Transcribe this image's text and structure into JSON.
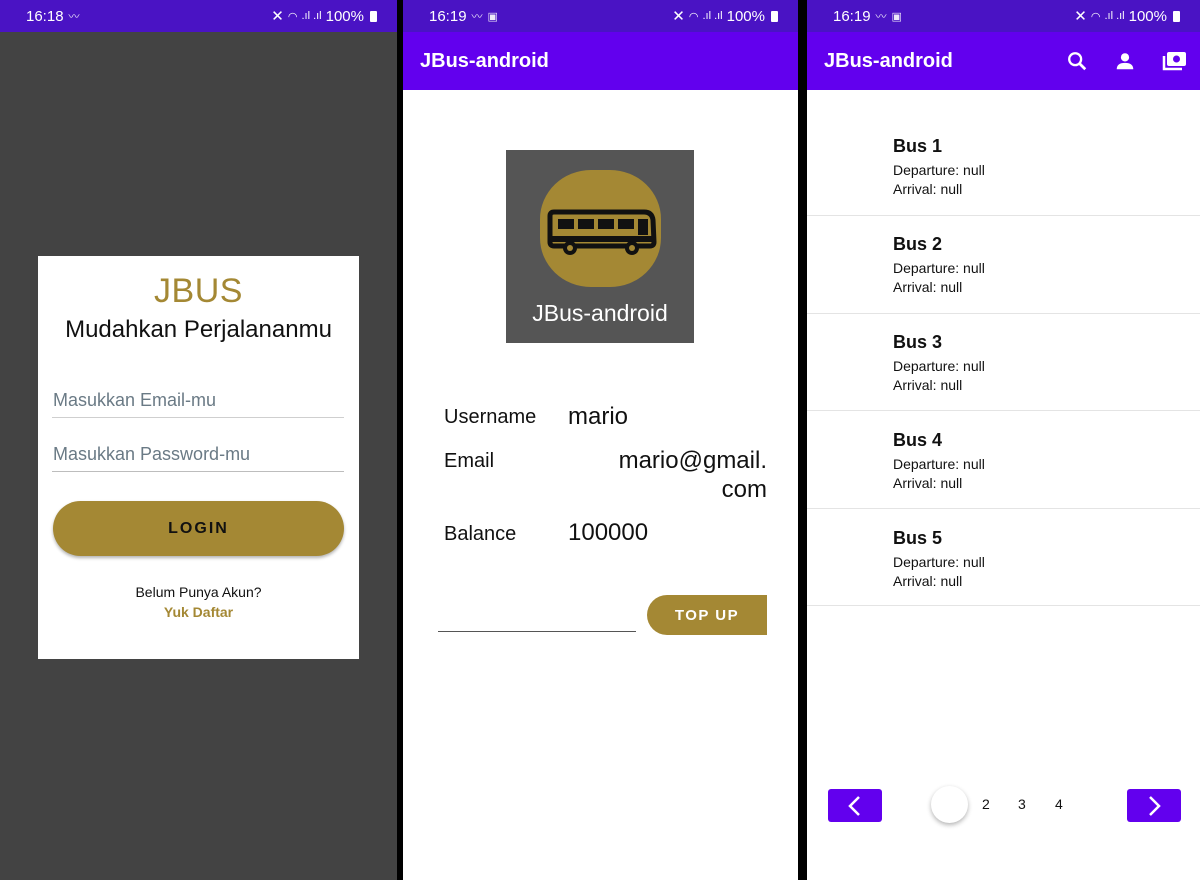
{
  "login_screen": {
    "status": {
      "time": "16:18",
      "battery": "100%"
    },
    "brand": "JBUS",
    "tagline": "Mudahkan Perjalananmu",
    "email_placeholder": "Masukkan Email-mu",
    "password_placeholder": "Masukkan Password-mu",
    "login_label": "LOGIN",
    "no_account_text": "Belum Punya Akun?",
    "register_link": "Yuk Daftar"
  },
  "profile_screen": {
    "status": {
      "time": "16:19",
      "battery": "100%"
    },
    "app_title": "JBus-android",
    "logo_text": "JBus-android",
    "username_label": "Username",
    "username_value": "mario",
    "email_label": "Email",
    "email_value": "mario@gmail.com",
    "balance_label": "Balance",
    "balance_value": "100000",
    "topup_label": "TOP UP"
  },
  "bus_list_screen": {
    "status": {
      "time": "16:19",
      "battery": "100%"
    },
    "app_title": "JBus-android",
    "buses": [
      {
        "name": "Bus 1",
        "departure": "Departure: null",
        "arrival": "Arrival: null"
      },
      {
        "name": "Bus 2",
        "departure": "Departure: null",
        "arrival": "Arrival: null"
      },
      {
        "name": "Bus 3",
        "departure": "Departure: null",
        "arrival": "Arrival: null"
      },
      {
        "name": "Bus 4",
        "departure": "Departure: null",
        "arrival": "Arrival: null"
      },
      {
        "name": "Bus 5",
        "departure": "Departure: null",
        "arrival": "Arrival: null"
      }
    ],
    "pages": [
      "2",
      "3",
      "4"
    ]
  },
  "colors": {
    "accent_gold": "#a48834",
    "primary_purple": "#6200ee",
    "statusbar_purple": "#4a13c4"
  },
  "icons": {
    "search": "search-icon",
    "profile": "person-icon",
    "payment": "payment-icon",
    "prev": "chevron-left-icon",
    "next": "chevron-right-icon"
  }
}
